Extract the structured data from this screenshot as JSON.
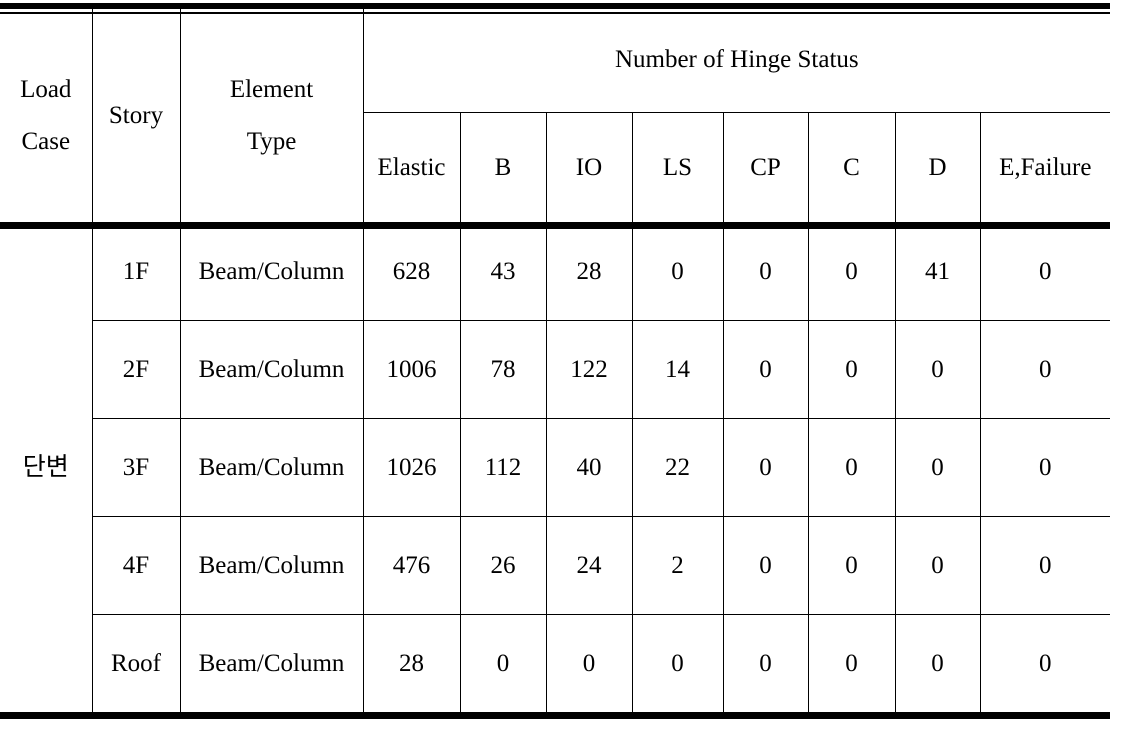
{
  "table": {
    "header": {
      "load_case": {
        "line1": "Load",
        "line2": "Case"
      },
      "story": "Story",
      "element_type": {
        "line1": "Element",
        "line2": "Type"
      },
      "group_title": "Number of Hinge Status",
      "hinge_columns": [
        "Elastic",
        "B",
        "IO",
        "LS",
        "CP",
        "C",
        "D",
        "E,Failure"
      ]
    },
    "load_case_label": "단변",
    "rows": [
      {
        "story": "1F",
        "element_type": "Beam/Column",
        "elastic": "628",
        "b": "43",
        "io": "28",
        "ls": "0",
        "cp": "0",
        "c": "0",
        "d": "41",
        "e_failure": "0"
      },
      {
        "story": "2F",
        "element_type": "Beam/Column",
        "elastic": "1006",
        "b": "78",
        "io": "122",
        "ls": "14",
        "cp": "0",
        "c": "0",
        "d": "0",
        "e_failure": "0"
      },
      {
        "story": "3F",
        "element_type": "Beam/Column",
        "elastic": "1026",
        "b": "112",
        "io": "40",
        "ls": "22",
        "cp": "0",
        "c": "0",
        "d": "0",
        "e_failure": "0"
      },
      {
        "story": "4F",
        "element_type": "Beam/Column",
        "elastic": "476",
        "b": "26",
        "io": "24",
        "ls": "2",
        "cp": "0",
        "c": "0",
        "d": "0",
        "e_failure": "0"
      },
      {
        "story": "Roof",
        "element_type": "Beam/Column",
        "elastic": "28",
        "b": "0",
        "io": "0",
        "ls": "0",
        "cp": "0",
        "c": "0",
        "d": "0",
        "e_failure": "0"
      }
    ]
  },
  "colors": {
    "text": "#000000",
    "rule": "#000000",
    "background": "#ffffff"
  }
}
